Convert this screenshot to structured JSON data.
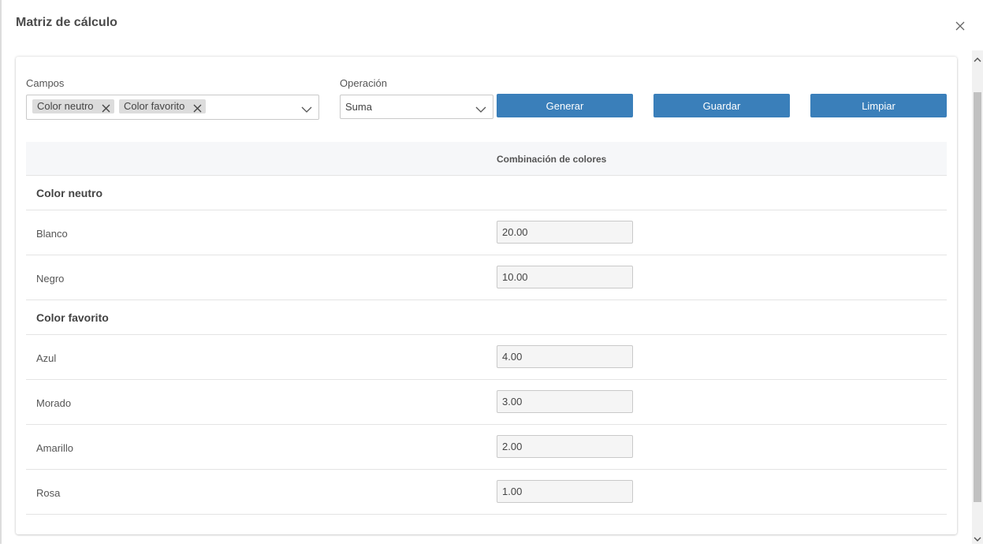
{
  "dialog": {
    "title": "Matriz de cálculo"
  },
  "form": {
    "campos_label": "Campos",
    "chips": [
      "Color neutro",
      "Color favorito"
    ],
    "operacion_label": "Operación",
    "operacion_value": "Suma",
    "buttons": {
      "generar": "Generar",
      "guardar": "Guardar",
      "limpiar": "Limpiar"
    }
  },
  "table": {
    "column_header": "Combinación de colores",
    "groups": [
      {
        "name": "Color neutro",
        "items": [
          {
            "label": "Blanco",
            "value": "20.00"
          },
          {
            "label": "Negro",
            "value": "10.00"
          }
        ]
      },
      {
        "name": "Color favorito",
        "items": [
          {
            "label": "Azul",
            "value": "4.00"
          },
          {
            "label": "Morado",
            "value": "3.00"
          },
          {
            "label": "Amarillo",
            "value": "2.00"
          },
          {
            "label": "Rosa",
            "value": "1.00"
          }
        ]
      }
    ]
  },
  "colors": {
    "primary_button": "#3a7fba",
    "chip_bg": "#dcdcdc",
    "header_bg": "#f6f7f9"
  },
  "icons": {
    "close": "close-icon",
    "chip_remove": "x-icon",
    "dropdown": "chevron-down-icon"
  }
}
